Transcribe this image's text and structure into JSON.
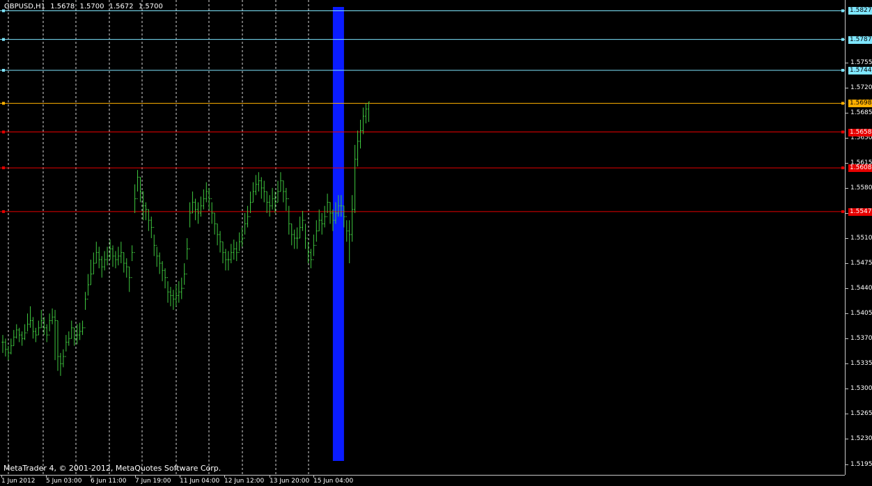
{
  "header": {
    "symbol": "GBPUSD,H1",
    "open": "1.5678",
    "high": "1.5700",
    "low": "1.5672",
    "close": "1.5700"
  },
  "footer": {
    "copyright": "MetaTrader 4, © 2001-2012, MetaQuotes Software Corp."
  },
  "colors": {
    "background": "#000000",
    "bars": "#3fc83f",
    "grid": "#ffffff",
    "cyan_level": "#7fe6ff",
    "orange_level": "#ffb000",
    "red_level": "#e60000",
    "highlight": "#0a1cff"
  },
  "price_axis": {
    "min": 1.518,
    "max": 1.5842,
    "ticks": [
      "1.5755",
      "1.5720",
      "1.5685",
      "1.5650",
      "1.5615",
      "1.5580",
      "1.5545",
      "1.5510",
      "1.5475",
      "1.5440",
      "1.5405",
      "1.5370",
      "1.5335",
      "1.5300",
      "1.5265",
      "1.5230",
      "1.5195"
    ]
  },
  "level_lines": [
    {
      "label": "1.5827",
      "kind": "cyan"
    },
    {
      "label": "1.5787",
      "kind": "cyan"
    },
    {
      "label": "1.5744",
      "kind": "cyan"
    },
    {
      "label": "1.5698",
      "kind": "orange"
    },
    {
      "label": "1.5658",
      "kind": "red"
    },
    {
      "label": "1.5608",
      "kind": "red"
    },
    {
      "label": "1.5547",
      "kind": "red"
    }
  ],
  "time_axis": {
    "labels": [
      "1 Jun 2012",
      "5 Jun 03:00",
      "6 Jun 11:00",
      "7 Jun 19:00",
      "11 Jun 04:00",
      "12 Jun 12:00",
      "13 Jun 20:00",
      "15 Jun 04:00"
    ]
  },
  "chart_data": {
    "type": "ohlc",
    "symbol": "GBPUSD",
    "timeframe": "H1",
    "ylim": [
      1.518,
      1.5842
    ],
    "highlight_bar_index": 122,
    "close": [
      1.5365,
      1.5355,
      1.535,
      1.536,
      1.5372,
      1.5382,
      1.5375,
      1.537,
      1.5378,
      1.539,
      1.5395,
      1.538,
      1.5375,
      1.5385,
      1.5395,
      1.5385,
      1.5375,
      1.5395,
      1.54,
      1.5395,
      1.5345,
      1.5335,
      1.5345,
      1.5365,
      1.537,
      1.5385,
      1.537,
      1.5375,
      1.538,
      1.5385,
      1.5425,
      1.5445,
      1.546,
      1.5475,
      1.549,
      1.548,
      1.547,
      1.548,
      1.5485,
      1.5495,
      1.5485,
      1.548,
      1.5485,
      1.549,
      1.5475,
      1.547,
      1.5455,
      1.549,
      1.5565,
      1.5595,
      1.5575,
      1.5555,
      1.555,
      1.5535,
      1.5525,
      1.55,
      1.5485,
      1.5475,
      1.5465,
      1.5455,
      1.5435,
      1.543,
      1.5425,
      1.543,
      1.5435,
      1.544,
      1.546,
      1.5495,
      1.5545,
      1.556,
      1.555,
      1.5545,
      1.5555,
      1.5565,
      1.5575,
      1.5565,
      1.5545,
      1.553,
      1.5515,
      1.5505,
      1.549,
      1.548,
      1.548,
      1.549,
      1.5495,
      1.549,
      1.5505,
      1.551,
      1.553,
      1.554,
      1.556,
      1.5575,
      1.5585,
      1.559,
      1.558,
      1.5575,
      1.556,
      1.5555,
      1.5565,
      1.556,
      1.5575,
      1.559,
      1.5575,
      1.5565,
      1.553,
      1.5515,
      1.551,
      1.551,
      1.5525,
      1.5535,
      1.551,
      1.549,
      1.548,
      1.55,
      1.552,
      1.5535,
      1.553,
      1.554,
      1.556,
      1.5545,
      1.5535,
      1.5545,
      1.5555,
      1.5555,
      1.554,
      1.552,
      1.5515,
      1.555,
      1.562,
      1.5645,
      1.566,
      1.568,
      1.569,
      1.57
    ],
    "high": [
      1.5375,
      1.537,
      1.536,
      1.537,
      1.5382,
      1.539,
      1.5385,
      1.538,
      1.539,
      1.5405,
      1.5415,
      1.54,
      1.5385,
      1.5395,
      1.541,
      1.54,
      1.539,
      1.5405,
      1.5412,
      1.541,
      1.5395,
      1.535,
      1.5355,
      1.5375,
      1.538,
      1.5395,
      1.5385,
      1.539,
      1.5392,
      1.5395,
      1.5435,
      1.546,
      1.548,
      1.549,
      1.5505,
      1.5498,
      1.5485,
      1.5492,
      1.5498,
      1.5508,
      1.55,
      1.5492,
      1.5498,
      1.5505,
      1.549,
      1.5482,
      1.547,
      1.55,
      1.5585,
      1.5605,
      1.5595,
      1.5575,
      1.556,
      1.555,
      1.554,
      1.5515,
      1.5498,
      1.549,
      1.5478,
      1.5468,
      1.545,
      1.5442,
      1.5438,
      1.5445,
      1.545,
      1.5455,
      1.5475,
      1.551,
      1.556,
      1.5575,
      1.5565,
      1.556,
      1.5568,
      1.5578,
      1.5588,
      1.558,
      1.556,
      1.5545,
      1.553,
      1.552,
      1.5505,
      1.5495,
      1.5492,
      1.5502,
      1.5508,
      1.5505,
      1.5518,
      1.5525,
      1.5545,
      1.5555,
      1.5575,
      1.5588,
      1.5598,
      1.5602,
      1.5595,
      1.559,
      1.5575,
      1.557,
      1.558,
      1.5575,
      1.559,
      1.5602,
      1.559,
      1.558,
      1.5555,
      1.553,
      1.5522,
      1.5525,
      1.554,
      1.5548,
      1.553,
      1.5505,
      1.5495,
      1.5515,
      1.5535,
      1.555,
      1.5545,
      1.5555,
      1.5572,
      1.556,
      1.555,
      1.556,
      1.557,
      1.557,
      1.5555,
      1.5535,
      1.5535,
      1.557,
      1.564,
      1.566,
      1.5675,
      1.5692,
      1.5698,
      1.57
    ],
    "low": [
      1.535,
      1.5345,
      1.534,
      1.5348,
      1.536,
      1.537,
      1.5365,
      1.536,
      1.5368,
      1.538,
      1.5385,
      1.537,
      1.5365,
      1.5375,
      1.5385,
      1.5375,
      1.5365,
      1.538,
      1.539,
      1.534,
      1.5325,
      1.5318,
      1.533,
      1.5352,
      1.536,
      1.537,
      1.536,
      1.5362,
      1.5368,
      1.5375,
      1.541,
      1.543,
      1.5445,
      1.546,
      1.5475,
      1.5468,
      1.5455,
      1.5465,
      1.5472,
      1.548,
      1.547,
      1.5468,
      1.5472,
      1.5475,
      1.5462,
      1.5455,
      1.5435,
      1.5478,
      1.5545,
      1.5575,
      1.556,
      1.5535,
      1.5535,
      1.552,
      1.551,
      1.5485,
      1.547,
      1.546,
      1.545,
      1.544,
      1.542,
      1.5415,
      1.541,
      1.5415,
      1.542,
      1.5425,
      1.5445,
      1.548,
      1.5525,
      1.5545,
      1.5535,
      1.553,
      1.554,
      1.555,
      1.556,
      1.555,
      1.553,
      1.5515,
      1.55,
      1.549,
      1.5475,
      1.5465,
      1.5465,
      1.5475,
      1.548,
      1.5478,
      1.5492,
      1.5498,
      1.5515,
      1.5525,
      1.5545,
      1.556,
      1.557,
      1.5575,
      1.5565,
      1.556,
      1.5545,
      1.554,
      1.555,
      1.5545,
      1.556,
      1.5575,
      1.556,
      1.5548,
      1.5515,
      1.55,
      1.5495,
      1.5495,
      1.551,
      1.552,
      1.5495,
      1.5475,
      1.5468,
      1.5485,
      1.5505,
      1.552,
      1.5515,
      1.5525,
      1.5545,
      1.553,
      1.552,
      1.553,
      1.554,
      1.554,
      1.5525,
      1.5505,
      1.5475,
      1.5505,
      1.5545,
      1.561,
      1.5635,
      1.5655,
      1.567,
      1.5672
    ]
  }
}
